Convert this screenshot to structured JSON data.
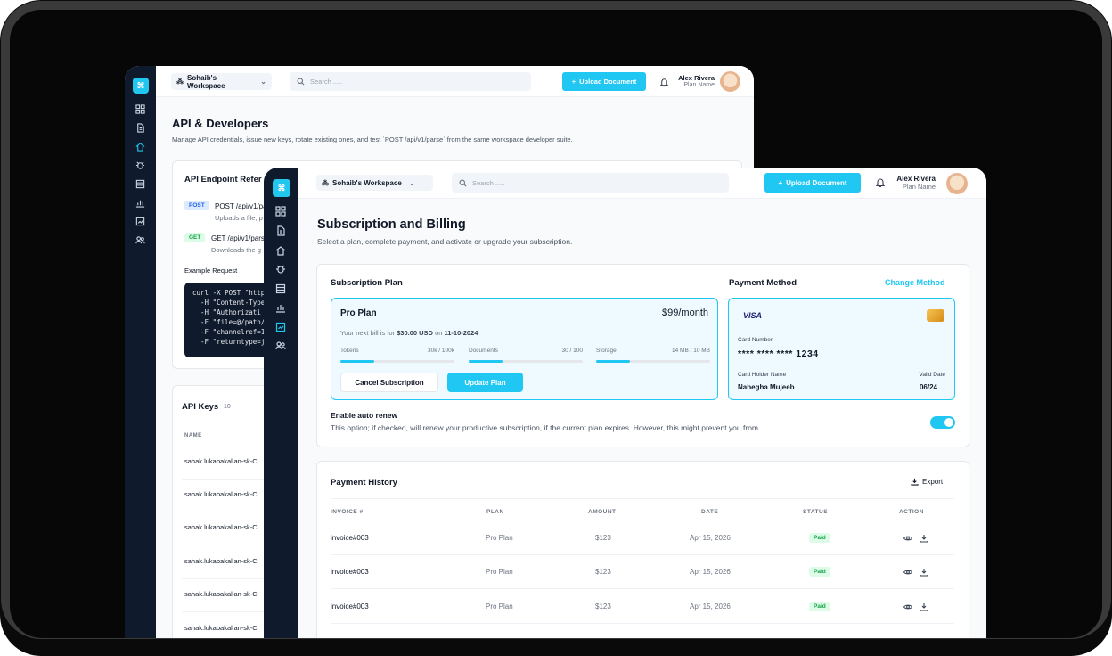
{
  "workspace_label": "Sohaib's Workspace",
  "search_placeholder": "Search .....",
  "upload_label": "Upload Document",
  "user": {
    "name": "Alex Rivera",
    "plan": "Plan Name"
  },
  "api": {
    "title": "API & Developers",
    "subtitle": "Manage API credentials, issue new keys, rotate existing ones, and test `POST /api/v1/parse` from the same workspace developer suite.",
    "reference_title": "API Endpoint Refer",
    "endpoints": [
      {
        "method": "POST",
        "path": "POST /api/v1/pa",
        "desc": "Uploads a file, p"
      },
      {
        "method": "GET",
        "path": "GET /api/v1/pars",
        "desc": "Downloads the g"
      }
    ],
    "example_label": "Example Request",
    "code_lines": [
      "curl -X POST \"http",
      "  -H \"Content-Type",
      "  -H \"Authorizati",
      "  -F \"file=@/path/",
      "  -F \"channelref=1",
      "  -F \"returntype=j"
    ],
    "keys_title": "API Keys",
    "keys_count": "10",
    "keys_col": "NAME",
    "keys": [
      "sahak.lukabakalian-sk-C",
      "sahak.lukabakalian-sk-C",
      "sahak.lukabakalian-sk-C",
      "sahak.lukabakalian-sk-C",
      "sahak.lukabakalian-sk-C",
      "sahak.lukabakalian-sk-C"
    ]
  },
  "billing": {
    "title": "Subscription and Billing",
    "subtitle": "Select a plan, complete payment, and activate or upgrade your subscription.",
    "plan_section": "Subscription Plan",
    "plan_name": "Pro Plan",
    "plan_price": "$99/month",
    "bill_prefix": "Your next bill is for",
    "bill_amount": "$30.00 USD",
    "bill_on": "on",
    "bill_date": "11-10-2024",
    "usage": [
      {
        "label": "Tokens",
        "value": "30k / 100k",
        "fraction": 0.3
      },
      {
        "label": "Documents",
        "value": "30 / 100",
        "fraction": 0.3
      },
      {
        "label": "Storage",
        "value": "14 MB / 10 MB",
        "fraction": 0.3
      }
    ],
    "cancel_label": "Cancel Subscription",
    "update_label": "Update Plan",
    "payment_section": "Payment Method",
    "change_label": "Change Method",
    "card_brand": "VISA",
    "card_number_label": "Card Number",
    "card_number": "**** **** **** 1234",
    "holder_label": "Card Holder Name",
    "holder": "Nabegha Mujeeb",
    "valid_label": "Valid Date",
    "valid": "06/24",
    "auto_renew_title": "Enable auto renew",
    "auto_renew_desc": "This option; if checked, will renew your productive subscription, if the current plan expires. However, this might prevent you from.",
    "auto_renew_on": true
  },
  "history": {
    "title": "Payment History",
    "export_label": "Export",
    "columns": [
      "INVOICE #",
      "PLAN",
      "AMOUNT",
      "DATE",
      "STATUS",
      "ACTION"
    ],
    "rows": [
      {
        "invoice": "invoice#003",
        "plan": "Pro Plan",
        "amount": "$123",
        "date": "Apr 15, 2026",
        "status": "Paid"
      },
      {
        "invoice": "invoice#003",
        "plan": "Pro Plan",
        "amount": "$123",
        "date": "Apr 15, 2026",
        "status": "Paid"
      },
      {
        "invoice": "invoice#003",
        "plan": "Pro Plan",
        "amount": "$123",
        "date": "Apr 15, 2026",
        "status": "Paid"
      }
    ]
  },
  "colors": {
    "accent": "#1fc7f2",
    "sidebar": "#0f1b2d",
    "paid": "#16a34a"
  }
}
